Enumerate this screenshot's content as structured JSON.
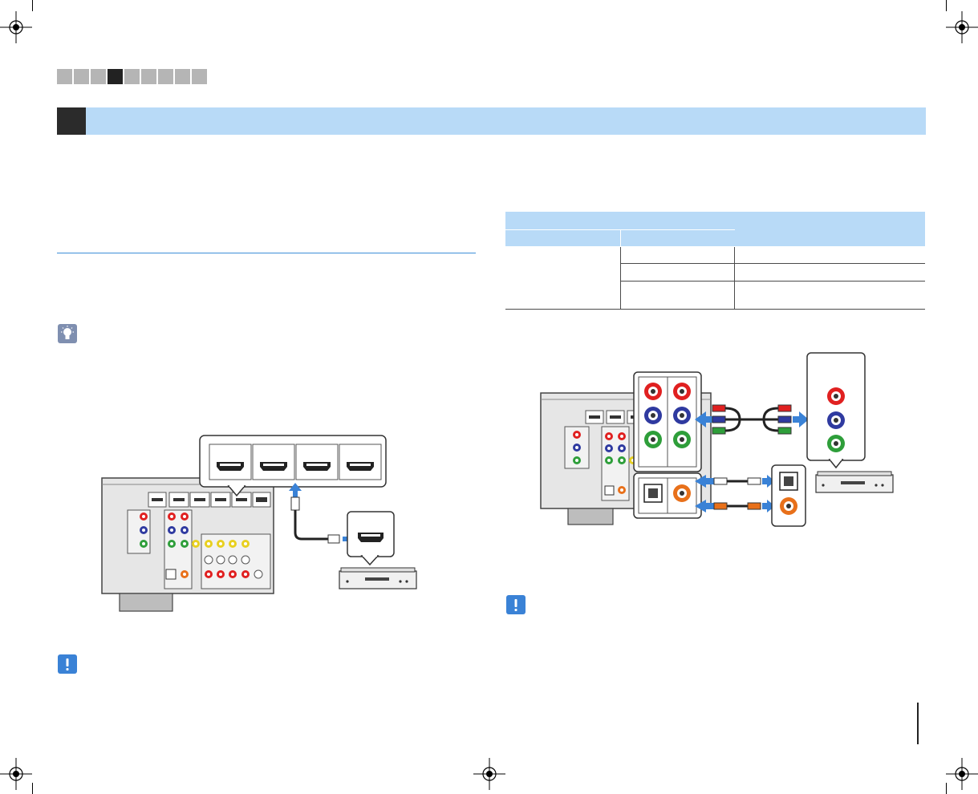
{
  "nav": {
    "tab_count": 9,
    "active_index": 3
  },
  "section": {
    "number": "",
    "title": ""
  },
  "spec_table": {
    "header_rows": [
      [
        "",
        ""
      ],
      [
        "",
        ""
      ]
    ],
    "rows": [
      [
        "",
        "",
        ""
      ],
      [
        "",
        ""
      ],
      [
        "",
        ""
      ]
    ]
  },
  "page_number": "",
  "colors": {
    "banner": "#b8daf7",
    "accent_blue": "#3d8fd8",
    "tab_inactive": "#b5b5b5",
    "tab_active": "#222222",
    "jack_red": "#e02020",
    "jack_blue": "#2f3aa0",
    "jack_green": "#2e9e3a",
    "jack_orange": "#e8701a"
  },
  "icons": {
    "hint": "lightbulb-icon",
    "note": "exclamation-icon",
    "crop_mark": "registration-crosshair-icon"
  }
}
